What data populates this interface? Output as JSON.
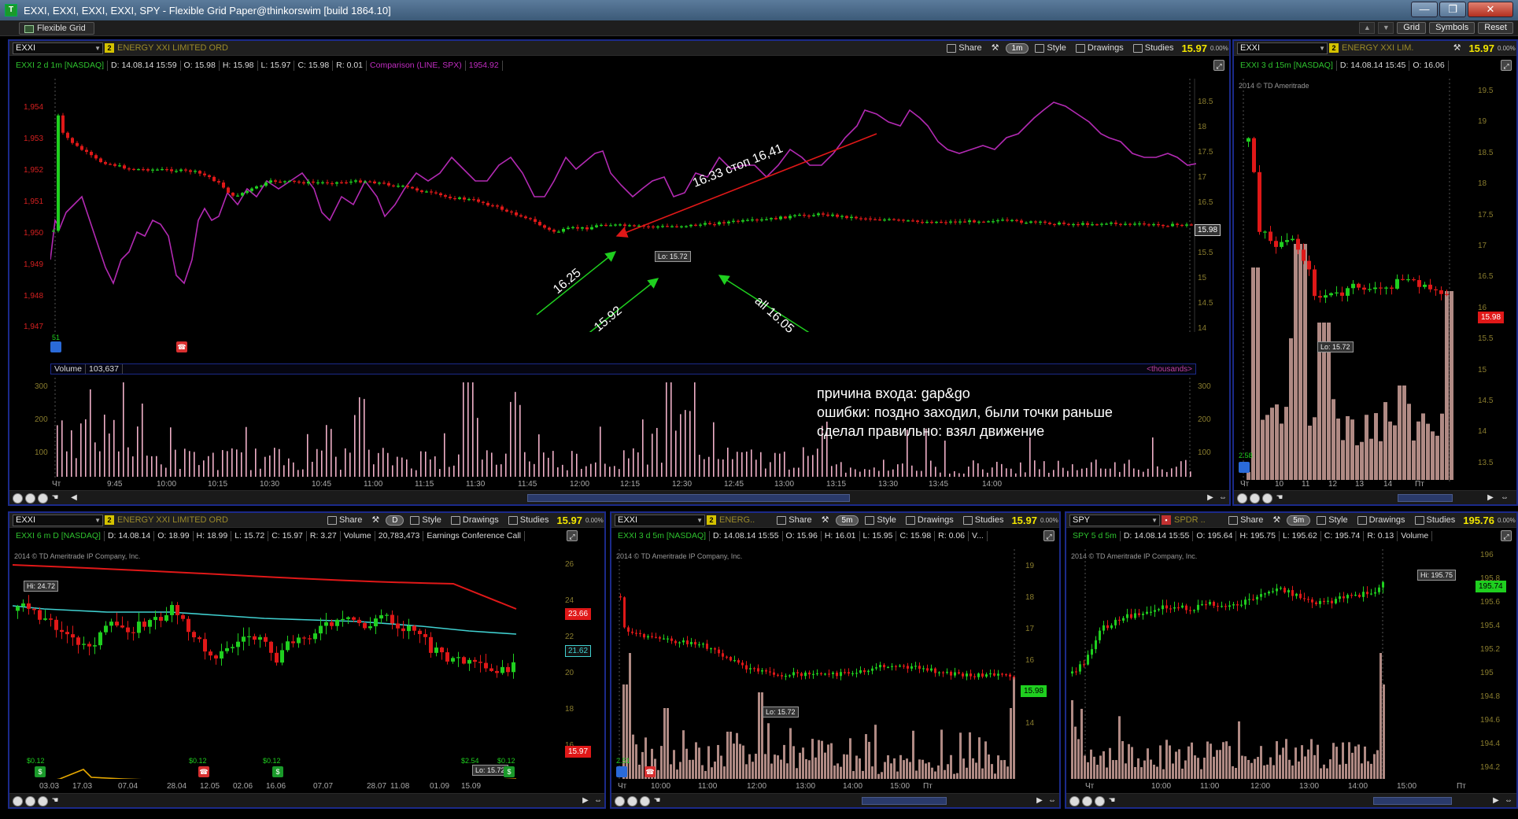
{
  "window": {
    "title": "EXXI, EXXI, EXXI, EXXI, SPY - Flexible Grid Paper@thinkorswim [build 1864.10]",
    "app_icon_letter": "T",
    "controls": {
      "minimize": "—",
      "maximize": "❐",
      "close": "✕"
    }
  },
  "topbar": {
    "tab_label": "Flexible Grid",
    "buttons": [
      "Grid",
      "Symbols",
      "Reset"
    ]
  },
  "common": {
    "share": "Share",
    "style": "Style",
    "drawings": "Drawings",
    "studies": "Studies",
    "pct": "0.00%",
    "link": "2",
    "copyright": "2014 © TD Ameritrade IP Company, Inc."
  },
  "panels": {
    "main": {
      "symbol": "EXXI",
      "company": "ENERGY XXI LIMITED ORD",
      "aggregation": "1m",
      "price": "15.97",
      "info": [
        "EXXI 2 d 1m [NASDAQ]",
        "D: 14.08.14 15:59",
        "O: 15.98",
        "H: 15.98",
        "L: 15.97",
        "C: 15.98",
        "R: 0.01"
      ],
      "comparison": "Comparison (LINE, SPX)",
      "comparison_value": "1954.92",
      "left_axis": [
        "1,954",
        "1,953",
        "1,952",
        "1,951",
        "1,950",
        "1,949",
        "1,948",
        "1,947"
      ],
      "right_axis": [
        "18.5",
        "18",
        "17.5",
        "17",
        "16.5",
        "16",
        "15.5",
        "15",
        "14.5",
        "14"
      ],
      "last_label": "15.98",
      "lo_label": "Lo: 15.72",
      "left_marker": "51",
      "volume_label": "Volume",
      "volume_value": "103,637",
      "thousands": "<thousands>",
      "vol_axis": [
        "300",
        "200",
        "100"
      ],
      "x_axis": [
        "Чт",
        "9:45",
        "10:00",
        "10:15",
        "10:30",
        "10:45",
        "11:00",
        "11:15",
        "11:30",
        "11:45",
        "12:00",
        "12:15",
        "12:30",
        "12:45",
        "13:00",
        "13:15",
        "13:30",
        "13:45",
        "14:00"
      ],
      "annotations": {
        "stop": "16.33 стоп 16,41",
        "a1": "16.25",
        "a2": "15.92",
        "a3": "all 16.05"
      },
      "notes": [
        "причина входа: gap&go",
        "ошибки: поздно заходил, были точки раньше",
        "сделал правильно: взял движение"
      ]
    },
    "right": {
      "symbol": "EXXI",
      "company": "ENERGY XXI LIM.",
      "price": "15.97",
      "info": [
        "EXXI 3 d 15m [NASDAQ]",
        "D: 14.08.14 15:45",
        "O: 16.06"
      ],
      "copyright": "2014 © TD Ameritrade",
      "right_axis": [
        "19.5",
        "19",
        "18.5",
        "18",
        "17.5",
        "17",
        "16.5",
        "16",
        "15.5",
        "15",
        "14.5",
        "14",
        "13.5"
      ],
      "last_label": "15.98",
      "lo_label": "Lo: 15.72",
      "left_marker": "2.58",
      "x_axis": [
        "Чт",
        "10",
        "11",
        "12",
        "13",
        "14",
        "Пт"
      ]
    },
    "bl": {
      "symbol": "EXXI",
      "company": "ENERGY XXI LIMITED ORD",
      "aggregation": "D",
      "price": "15.97",
      "info": [
        "EXXI 6 m D [NASDAQ]",
        "D: 14.08.14",
        "O: 18.99",
        "H: 18.99",
        "L: 15.72",
        "C: 15.97",
        "R: 3.27",
        "Volume",
        "20,783,473",
        "Earnings Conference Call"
      ],
      "right_axis": [
        "26",
        "24",
        "22",
        "20",
        "18",
        "16"
      ],
      "labels": {
        "red": "23.66",
        "cyan": "21.62",
        "last": "15.97"
      },
      "hi_label": "Hi: 24.72",
      "lo_label": "Lo: 15.72",
      "div_labels": [
        "$0.12",
        "$0.12",
        "$0.12",
        "$2.54",
        "$0.12"
      ],
      "x_axis": [
        "03.03",
        "17.03",
        "07.04",
        "28.04",
        "12.05",
        "02.06",
        "16.06",
        "07.07",
        "28.07",
        "11.08",
        "01.09",
        "15.09"
      ]
    },
    "bm": {
      "symbol": "EXXI",
      "company": "ENERG..",
      "aggregation": "5m",
      "price": "15.97",
      "info": [
        "EXXI 3 d 5m [NASDAQ]",
        "D: 14.08.14 15:55",
        "O: 15.96",
        "H: 16.01",
        "L: 15.95",
        "C: 15.98",
        "R: 0.06",
        "V..."
      ],
      "right_axis": [
        "19",
        "18",
        "17",
        "16",
        "15",
        "14"
      ],
      "last_label": "15.98",
      "lo_label": "Lo: 15.72",
      "left_marker": "2.51",
      "x_axis": [
        "Чт",
        "10:00",
        "11:00",
        "12:00",
        "13:00",
        "14:00",
        "15:00",
        "Пт"
      ]
    },
    "br": {
      "symbol": "SPY",
      "company": "SPDR ..",
      "aggregation": "5m",
      "price": "195.76",
      "info": [
        "SPY 5 d 5m",
        "D: 14.08.14 15:55",
        "O: 195.64",
        "H: 195.75",
        "L: 195.62",
        "C: 195.74",
        "R: 0.13",
        "Volume"
      ],
      "right_axis": [
        "196",
        "195.8",
        "195.6",
        "195.4",
        "195.2",
        "195",
        "194.8",
        "194.6",
        "194.4",
        "194.2"
      ],
      "last_label": "195.74",
      "hi_label": "Hi: 195.75",
      "x_axis": [
        "Чт",
        "10:00",
        "11:00",
        "12:00",
        "13:00",
        "14:00",
        "15:00",
        "Пт"
      ]
    }
  },
  "colors": {
    "up": "#1fcf1f",
    "down": "#e01818",
    "comparison": "#b32ab3",
    "volume": "#f0b0c8",
    "volume_fill": "#b08a84",
    "accent": "#f3e600",
    "border": "#1b2a8a"
  }
}
